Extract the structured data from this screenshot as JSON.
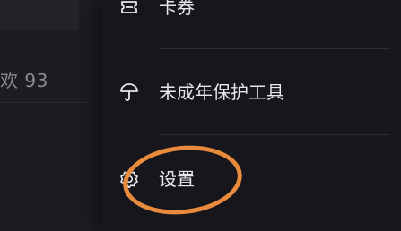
{
  "background_page": {
    "partial_text": "欢 93"
  },
  "drawer": {
    "items": [
      {
        "label": "卡券",
        "icon": "ticket-icon"
      },
      {
        "label": "未成年保护工具",
        "icon": "umbrella-icon"
      },
      {
        "label": "设置",
        "icon": "gear-icon"
      }
    ]
  },
  "annotation": {
    "color": "#e98b3d",
    "target": "设置"
  },
  "colors": {
    "drawer_bg": "#16161c",
    "text": "#e8e8ec",
    "divider": "#2b2b33"
  }
}
